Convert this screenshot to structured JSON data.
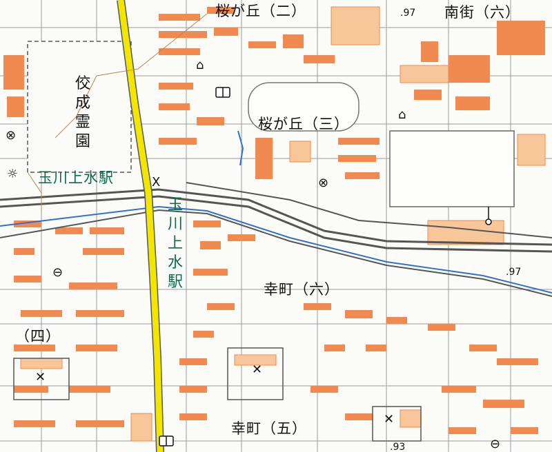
{
  "map": {
    "area_labels": {
      "sakuragaoka2": "桜が丘（二）",
      "sakuragaoka3": "桜が丘（三）",
      "minamimachi6": "南街（六）",
      "saiwaicho6": "幸町（六）",
      "saiwaicho5": "幸町（五）",
      "shi4": "（四）"
    },
    "cemetery_label": "佼成霊園",
    "station": {
      "horizontal": "玉川上水駅",
      "vertical": "玉川上水駅"
    },
    "elevations": {
      "e1": ".97",
      "e2": ".97",
      "e3": ".93"
    },
    "symbols": {
      "sym1": "⊗",
      "sym2": "⊗",
      "sym3": "☼",
      "sym4": "⊖",
      "sym5": "⊖",
      "sym6": "⌂",
      "sym7": "⌂",
      "sym8": "✕",
      "sym9": "✕",
      "sym10": "✕",
      "sym11": "X"
    },
    "colors": {
      "building": "#f08a50",
      "building_fill": "#f7c79a",
      "rail": "#555555",
      "highway": "#f2e600",
      "water": "#2f6fd1",
      "station_text": "#0a6b49"
    }
  }
}
